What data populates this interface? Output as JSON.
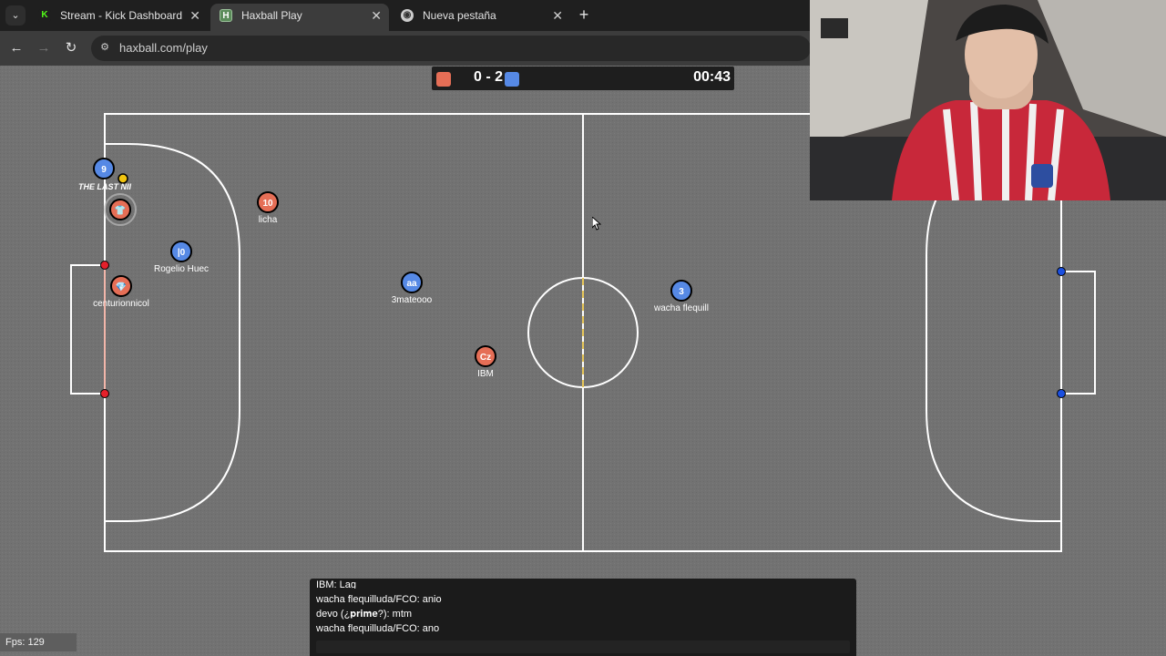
{
  "browser": {
    "tabs": [
      {
        "title": "Stream - Kick Dashboard",
        "favicon": "kick-icon",
        "active": false
      },
      {
        "title": "Haxball Play",
        "favicon": "haxball-icon",
        "active": true
      },
      {
        "title": "Nueva pestaña",
        "favicon": "chrome-icon",
        "active": false
      }
    ],
    "url": "haxball.com/play"
  },
  "scoreboard": {
    "score": "0 - 2",
    "time": "00:43",
    "red_color": "#e56e56",
    "blue_color": "#5689e5"
  },
  "players": [
    {
      "team": "blue",
      "number": "9",
      "name": "THE LAST NII"
    },
    {
      "team": "red",
      "number": "10",
      "name": "licha"
    },
    {
      "team": "red",
      "number": "👕",
      "name": ""
    },
    {
      "team": "blue",
      "number": "|0",
      "name": "Rogelio Huec"
    },
    {
      "team": "red",
      "number": "💎",
      "name": "centurionnicol"
    },
    {
      "team": "blue",
      "number": "aa",
      "name": "3mateooo"
    },
    {
      "team": "red",
      "number": "Cz",
      "name": "IBM"
    },
    {
      "team": "blue",
      "number": "3",
      "name": "wacha flequill"
    }
  ],
  "chat": {
    "messages": [
      "IBM: Lag",
      "wacha flequilluda/FCO: anio",
      "devo (¿𝐩𝐫𝐢𝐦𝐞?): mtm",
      "wacha flequilluda/FCO: ano"
    ]
  },
  "fps": "Fps: 129"
}
